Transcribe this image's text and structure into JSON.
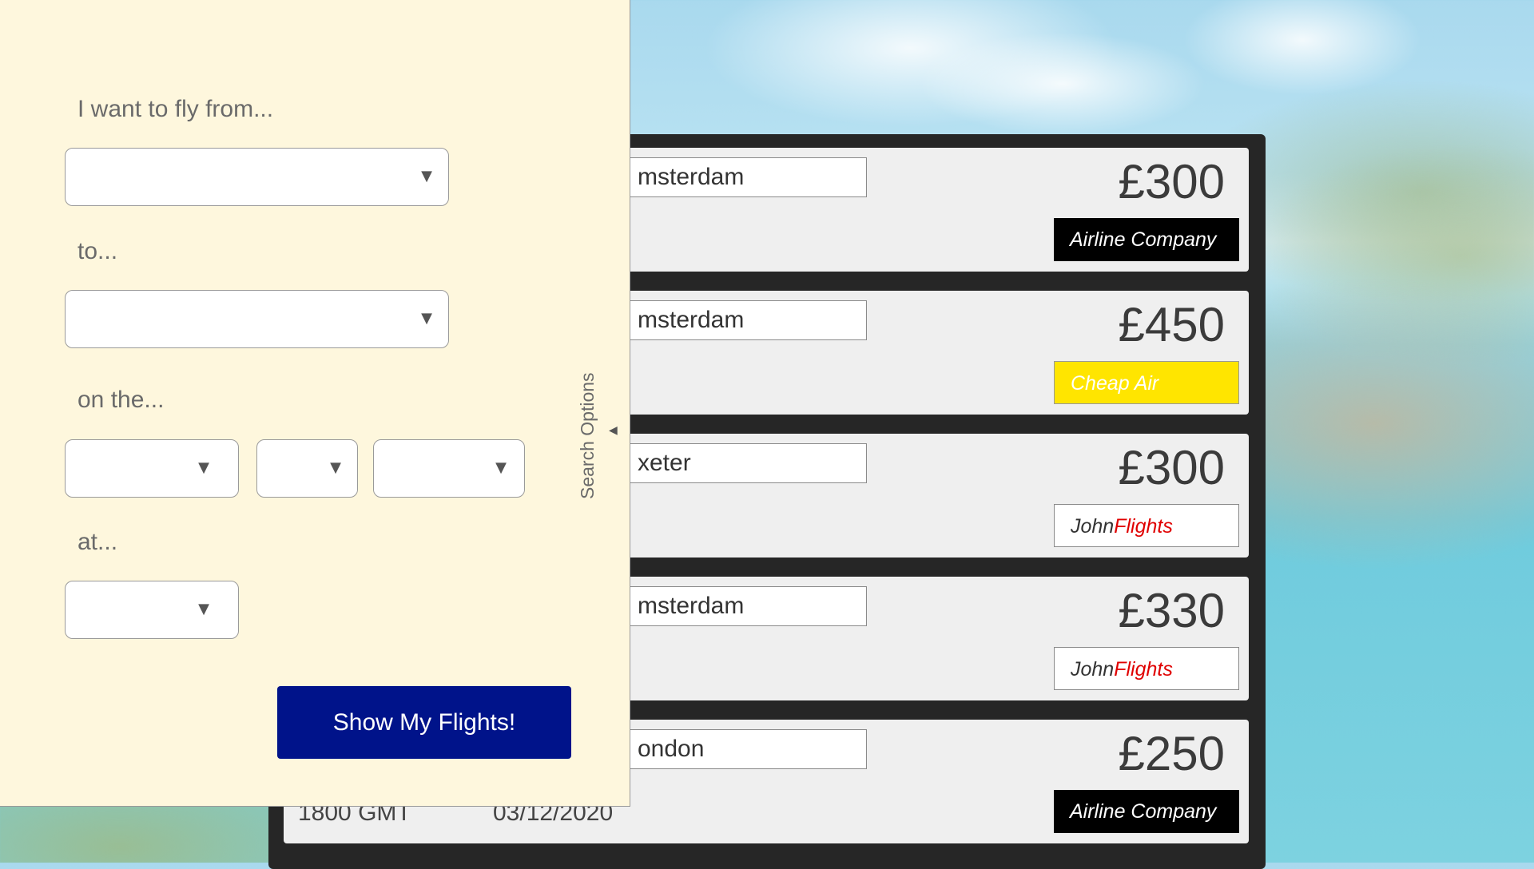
{
  "search": {
    "from_label": "I want to fly from...",
    "to_label": "to...",
    "date_label": "on the...",
    "time_label": "at...",
    "from_value": "",
    "to_value": "",
    "day_value": "",
    "month_value": "",
    "year_value": "",
    "time_value": "",
    "arrow": "▼",
    "submit_label": "Show My Flights!",
    "tab_label": "Search Options",
    "collapse_arrow": "◀"
  },
  "results": [
    {
      "city": "msterdam",
      "price": "£300",
      "airline_main": "Airline Company",
      "airline_accent": "",
      "airline_style": "dark",
      "time": "",
      "date": ""
    },
    {
      "city": "msterdam",
      "price": "£450",
      "airline_main": "Cheap Air",
      "airline_accent": "",
      "airline_style": "yellow",
      "time": "",
      "date": ""
    },
    {
      "city": "xeter",
      "price": "£300",
      "airline_main": "John",
      "airline_accent": "Flights",
      "airline_style": "white",
      "time": "",
      "date": ""
    },
    {
      "city": "msterdam",
      "price": "£330",
      "airline_main": "John",
      "airline_accent": "Flights",
      "airline_style": "white",
      "time": "",
      "date": ""
    },
    {
      "city": "ondon",
      "price": "£250",
      "airline_main": "Airline Company",
      "airline_accent": "",
      "airline_style": "dark",
      "time": "1800 GMT",
      "date": "03/12/2020"
    }
  ],
  "colors": {
    "panel_bg": "#fef7dd",
    "submit_bg": "#00138a",
    "cheap_air_yellow": "#ffe500",
    "johnflights_red": "#e00000"
  }
}
